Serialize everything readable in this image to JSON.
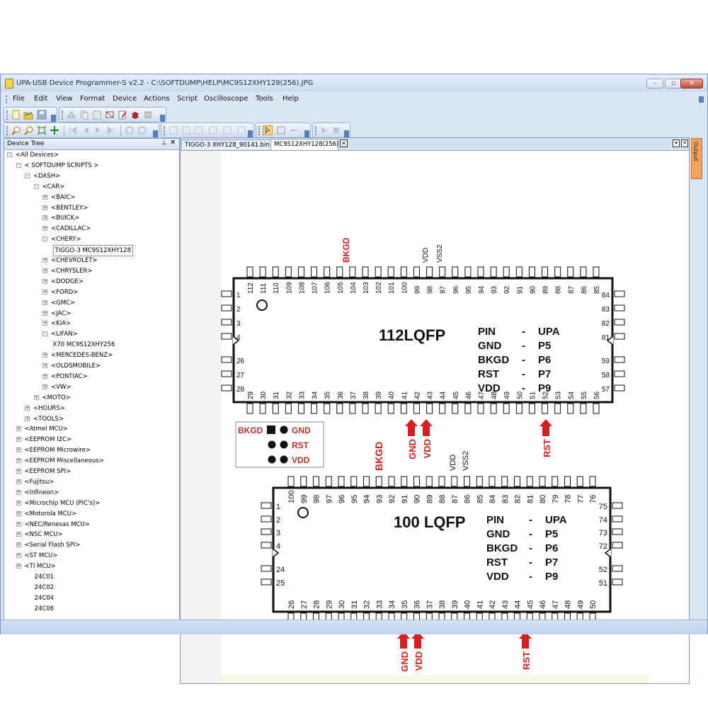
{
  "window": {
    "title": "UPA-USB Device Programmer-S v2.2 - C:\\SOFTDUMP\\HELP\\MC9S12XHY128(256).JPG",
    "minimize": "–",
    "restore": "▫",
    "close": "✕"
  },
  "menu": [
    "File",
    "Edit",
    "View",
    "Format",
    "Device",
    "Actions",
    "Script",
    "Oscilloscope",
    "Tools",
    "Help"
  ],
  "panel": {
    "title": "Device Tree"
  },
  "tree": [
    {
      "label": "<All Devices>",
      "indent": 0,
      "expand": "-"
    },
    {
      "label": "< SOFTDUMP SCRIPTS >",
      "indent": 1,
      "expand": "-"
    },
    {
      "label": "<DASH>",
      "indent": 2,
      "expand": "-"
    },
    {
      "label": "<CAR>",
      "indent": 3,
      "expand": "-"
    },
    {
      "label": "<BAIC>",
      "indent": 4,
      "expand": "+"
    },
    {
      "label": "<BENTLEY>",
      "indent": 4,
      "expand": "+"
    },
    {
      "label": "<BUICK>",
      "indent": 4,
      "expand": "+"
    },
    {
      "label": "<CADILLAC>",
      "indent": 4,
      "expand": "+"
    },
    {
      "label": "<CHERY>",
      "indent": 4,
      "expand": "-"
    },
    {
      "label": "TIGGO-3 MC9S12XHY128",
      "indent": 5,
      "expand": "",
      "selected": true
    },
    {
      "label": "<CHEVROLET>",
      "indent": 4,
      "expand": "+"
    },
    {
      "label": "<CHRYSLER>",
      "indent": 4,
      "expand": "+"
    },
    {
      "label": "<DODGE>",
      "indent": 4,
      "expand": "+"
    },
    {
      "label": "<FORD>",
      "indent": 4,
      "expand": "+"
    },
    {
      "label": "<GMC>",
      "indent": 4,
      "expand": "+"
    },
    {
      "label": "<JAC>",
      "indent": 4,
      "expand": "+"
    },
    {
      "label": "<KIA>",
      "indent": 4,
      "expand": "+"
    },
    {
      "label": "<LIFAN>",
      "indent": 4,
      "expand": "-"
    },
    {
      "label": "X70 MC9S12XHY256",
      "indent": 5,
      "expand": ""
    },
    {
      "label": "<MERCEDES-BENZ>",
      "indent": 4,
      "expand": "+"
    },
    {
      "label": "<OLDSMOBILE>",
      "indent": 4,
      "expand": "+"
    },
    {
      "label": "<PONTIAC>",
      "indent": 4,
      "expand": "+"
    },
    {
      "label": "<VW>",
      "indent": 4,
      "expand": "+"
    },
    {
      "label": "<MOTO>",
      "indent": 3,
      "expand": "+"
    },
    {
      "label": "<HOURS>",
      "indent": 2,
      "expand": "+"
    },
    {
      "label": "<TOOLS>",
      "indent": 2,
      "expand": "+"
    },
    {
      "label": "<Atmel MCU>",
      "indent": 1,
      "expand": "+"
    },
    {
      "label": "<EEPROM I2C>",
      "indent": 1,
      "expand": "+"
    },
    {
      "label": "<EEPROM Microwire>",
      "indent": 1,
      "expand": "+"
    },
    {
      "label": "<EEPROM Miscellaneous>",
      "indent": 1,
      "expand": "+"
    },
    {
      "label": "<EEPROM SPI>",
      "indent": 1,
      "expand": "+"
    },
    {
      "label": "<Fujitsu>",
      "indent": 1,
      "expand": "+"
    },
    {
      "label": "<Infineon>",
      "indent": 1,
      "expand": "+"
    },
    {
      "label": "<Microchip MCU (PIC's)>",
      "indent": 1,
      "expand": "+"
    },
    {
      "label": "<Motorola MCU>",
      "indent": 1,
      "expand": "+"
    },
    {
      "label": "<NEC/Renesas MCU>",
      "indent": 1,
      "expand": "+"
    },
    {
      "label": "<NSC MCU>",
      "indent": 1,
      "expand": "+"
    },
    {
      "label": "<Serial Flash SPI>",
      "indent": 1,
      "expand": "+"
    },
    {
      "label": "<ST MCU>",
      "indent": 1,
      "expand": "+"
    },
    {
      "label": "<TI MCU>",
      "indent": 1,
      "expand": "+"
    },
    {
      "label": "24C01",
      "indent": 1,
      "expand": ""
    },
    {
      "label": "24C02",
      "indent": 1,
      "expand": ""
    },
    {
      "label": "24C04",
      "indent": 1,
      "expand": ""
    },
    {
      "label": "24C08",
      "indent": 1,
      "expand": ""
    }
  ],
  "tabs": [
    "TIGGO-3 XHY128_90141.bin",
    "MC9S12XHY128(256)"
  ],
  "output_label": "Output",
  "diagram": {
    "pkg1": {
      "name": "112LQFP",
      "top_pins": [
        "112",
        "111",
        "110",
        "109",
        "108",
        "107",
        "106",
        "105",
        "104",
        "103",
        "102",
        "101",
        "100",
        "99",
        "98",
        "97",
        "96",
        "95",
        "94",
        "93",
        "92",
        "91",
        "90",
        "89",
        "88",
        "87",
        "86",
        "85"
      ],
      "bottom_pins": [
        "29",
        "30",
        "31",
        "32",
        "33",
        "34",
        "35",
        "36",
        "37",
        "38",
        "39",
        "40",
        "41",
        "42",
        "43",
        "44",
        "45",
        "46",
        "47",
        "48",
        "49",
        "50",
        "51",
        "52",
        "53",
        "54",
        "55",
        "56"
      ],
      "left_pins": [
        "1",
        "2",
        "3",
        "4",
        "26",
        "27",
        "28"
      ],
      "right_pins": [
        "84",
        "83",
        "82",
        "81",
        "59",
        "58",
        "57"
      ],
      "top_labels": [
        "BKGD",
        "VDD",
        "VSS2"
      ],
      "bottom_arrows": [
        "GND",
        "VDD",
        "RST"
      ],
      "table": [
        [
          "PIN",
          "-",
          "UPA"
        ],
        [
          "GND",
          "-",
          "P5"
        ],
        [
          "BKGD",
          "-",
          "P6"
        ],
        [
          "RST",
          "-",
          "P7"
        ],
        [
          "VDD",
          "-",
          "P9"
        ]
      ]
    },
    "connector": {
      "left": "BKGD",
      "right": [
        "GND",
        "RST",
        "VDD"
      ]
    },
    "pkg2": {
      "name": "100 LQFP",
      "top_pins": [
        "100",
        "99",
        "98",
        "97",
        "96",
        "95",
        "94",
        "93",
        "92",
        "91",
        "90",
        "89",
        "88",
        "87",
        "86",
        "85",
        "84",
        "83",
        "82",
        "81",
        "80",
        "79",
        "78",
        "77",
        "76"
      ],
      "bottom_pins": [
        "26",
        "27",
        "28",
        "29",
        "30",
        "31",
        "32",
        "33",
        "34",
        "35",
        "36",
        "37",
        "38",
        "39",
        "40",
        "41",
        "42",
        "43",
        "44",
        "45",
        "46",
        "47",
        "48",
        "49",
        "50"
      ],
      "left_pins": [
        "1",
        "2",
        "3",
        "4",
        "24",
        "25"
      ],
      "right_pins": [
        "75",
        "74",
        "73",
        "72",
        "52",
        "51"
      ],
      "top_labels": [
        "BKGD",
        "VDD",
        "VSS2"
      ],
      "bottom_arrows": [
        "GND",
        "VDD",
        "RST"
      ],
      "table": [
        [
          "PIN",
          "-",
          "UPA"
        ],
        [
          "GND",
          "-",
          "P5"
        ],
        [
          "BKGD",
          "-",
          "P6"
        ],
        [
          "RST",
          "-",
          "P7"
        ],
        [
          "VDD",
          "-",
          "P9"
        ]
      ]
    },
    "colors": {
      "red": "#d81e1e",
      "black": "#111111",
      "pinfill": "#ffffff"
    }
  }
}
